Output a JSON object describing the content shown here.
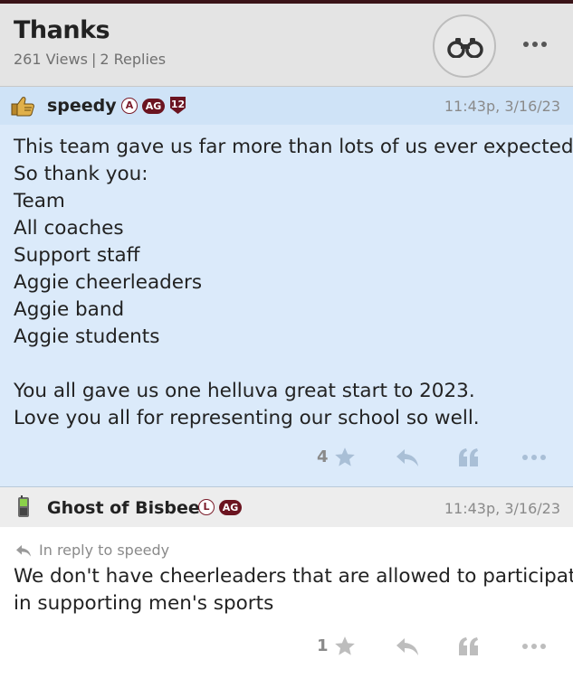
{
  "topic": {
    "title": "Thanks",
    "views": "261 Views",
    "separator": "|",
    "replies": "2 Replies"
  },
  "icons": {
    "watch": "binoculars-icon",
    "more": "more-horizontal-icon",
    "star": "star-icon",
    "reply": "reply-arrow-icon",
    "quote": "quote-icon"
  },
  "colors": {
    "header_bg": "#e4e4e4",
    "post_header_blue": "#cfe3f7",
    "post_body_blue": "#dbeafa",
    "maroon": "#6b1420",
    "muted": "#8a8a8a"
  },
  "posts": [
    {
      "author": "speedy",
      "badges": [
        "A",
        "AG",
        "12"
      ],
      "timestamp": "11:43p, 3/16/23",
      "lines": [
        "This team gave us far more than lots of us ever expected.",
        "So thank you:",
        "Team",
        "All coaches",
        "Support staff",
        "Aggie cheerleaders",
        "Aggie band",
        "Aggie students",
        "",
        "You all gave us one helluva great start to 2023.",
        "Love you all for representing our school so well."
      ],
      "star_count": "4"
    },
    {
      "author": "Ghost of Bisbee",
      "badges": [
        "L",
        "AG"
      ],
      "timestamp": "11:43p, 3/16/23",
      "reply_to": "In reply to speedy",
      "lines": [
        "We don't have cheerleaders that are allowed to participate",
        "in supporting men's sports"
      ],
      "star_count": "1"
    }
  ]
}
